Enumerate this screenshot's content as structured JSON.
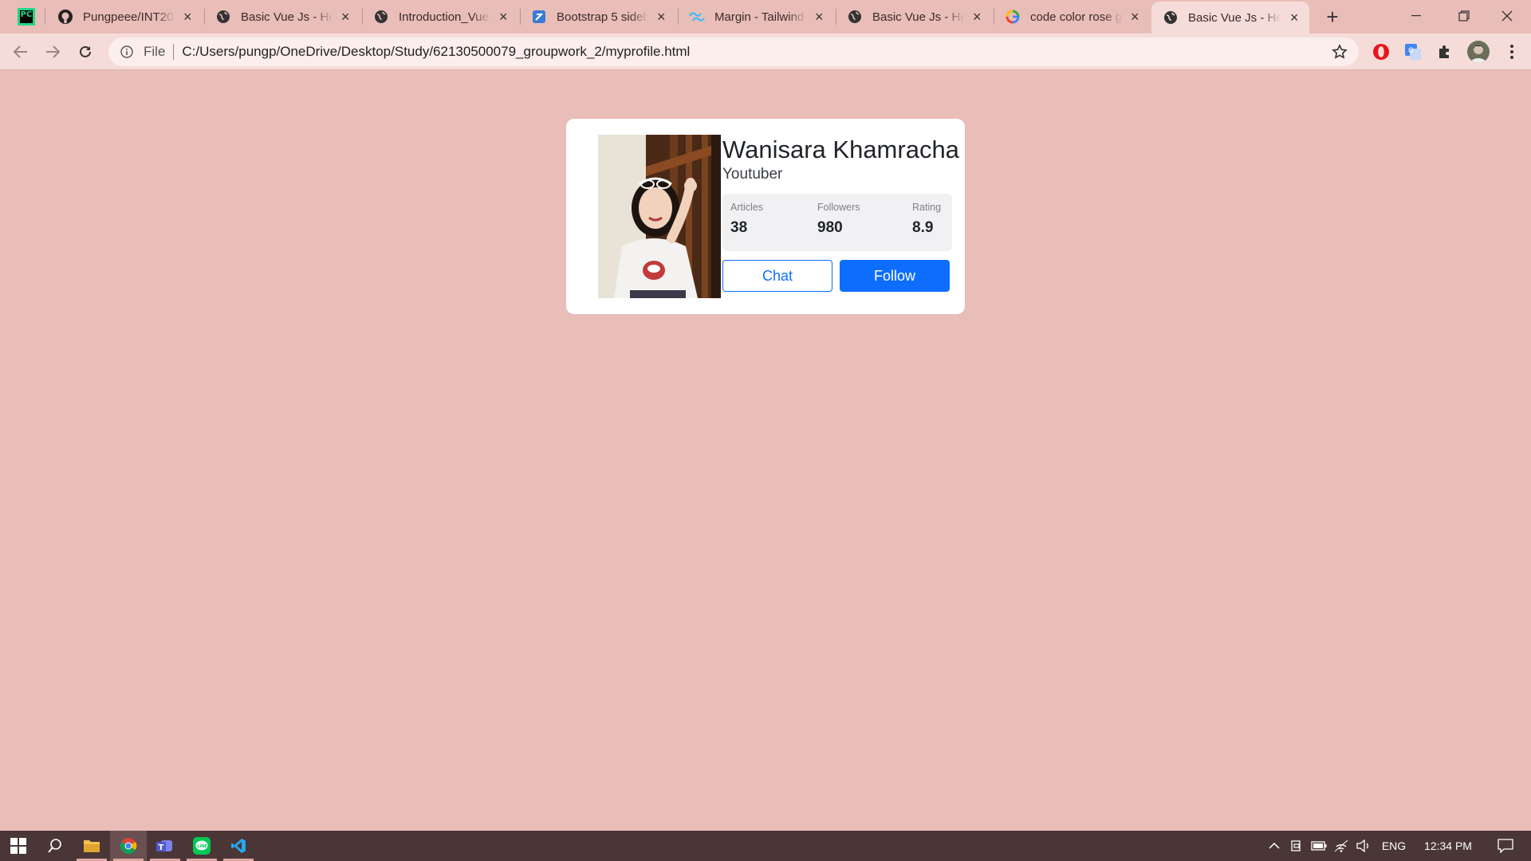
{
  "browser": {
    "tabs": [
      {
        "title": "Pungpeee/INT20",
        "icon": "github-icon"
      },
      {
        "title": "Basic Vue Js - Hel",
        "icon": "globe-icon"
      },
      {
        "title": "Introduction_Vue",
        "icon": "globe-icon"
      },
      {
        "title": "Bootstrap 5 sideb",
        "icon": "bootstrap-icon"
      },
      {
        "title": "Margin - Tailwind",
        "icon": "tailwind-icon"
      },
      {
        "title": "Basic Vue Js - Hel",
        "icon": "globe-icon"
      },
      {
        "title": "code color rose g",
        "icon": "google-icon"
      },
      {
        "title": "Basic Vue Js - Hel",
        "icon": "globe-icon",
        "active": true
      }
    ],
    "address": {
      "scheme_label": "File",
      "url": "C:/Users/pungp/OneDrive/Desktop/Study/62130500079_groupwork_2/myprofile.html"
    }
  },
  "profile": {
    "name": "Wanisara Khamracha",
    "role": "Youtuber",
    "stats": {
      "articles_label": "Articles",
      "articles_value": "38",
      "followers_label": "Followers",
      "followers_value": "980",
      "rating_label": "Rating",
      "rating_value": "8.9"
    },
    "chat_label": "Chat",
    "follow_label": "Follow"
  },
  "taskbar": {
    "language": "ENG",
    "time": "12:34 PM"
  },
  "colors": {
    "page_bg": "#e9bdb8",
    "accent": "#0d6efd",
    "card_bg": "#ffffff"
  }
}
